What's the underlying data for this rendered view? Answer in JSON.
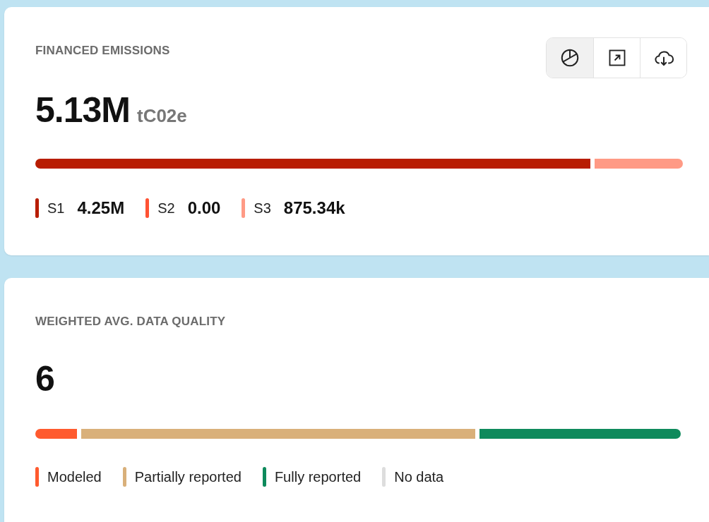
{
  "financed_emissions": {
    "title": "FINANCED EMISSIONS",
    "value": "5.13M",
    "unit": "tC02e",
    "tools": [
      {
        "kind": "chart",
        "selected": true
      },
      {
        "kind": "expand",
        "selected": false
      },
      {
        "kind": "download",
        "selected": false
      }
    ],
    "scopes": [
      {
        "label": "S1",
        "value": "4.25M",
        "color": "#b81d02"
      },
      {
        "label": "S2",
        "value": "0.00",
        "color": "#ff5233"
      },
      {
        "label": "S3",
        "value": "875.34k",
        "color": "#ff9a85"
      }
    ]
  },
  "data_quality": {
    "title": "WEIGHTED AVG. DATA QUALITY",
    "value": "6",
    "categories": [
      {
        "label": "Modeled",
        "color": "#ff5a2e"
      },
      {
        "label": "Partially reported",
        "color": "#d9b07a"
      },
      {
        "label": "Fully reported",
        "color": "#0e8a5c"
      },
      {
        "label": "No data",
        "color": "#dddddd"
      }
    ]
  }
}
